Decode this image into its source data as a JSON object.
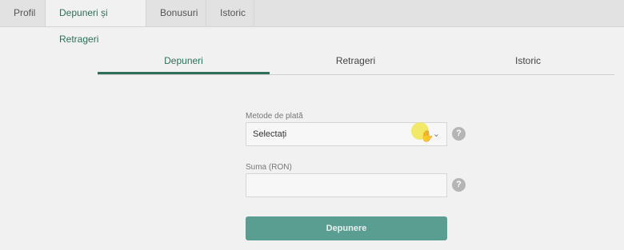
{
  "top_tabs": [
    {
      "label": "Profil"
    },
    {
      "label": "Depuneri și Retrageri"
    },
    {
      "label": "Bonusuri"
    },
    {
      "label": "Istoric"
    }
  ],
  "sub_tabs": [
    {
      "label": "Depuneri"
    },
    {
      "label": "Retrageri"
    },
    {
      "label": "Istoric"
    }
  ],
  "form": {
    "payment_method_label": "Metode de plată",
    "payment_method_value": "Selectați",
    "amount_label": "Suma (RON)",
    "amount_value": "",
    "help_glyph": "?",
    "submit_label": "Depunere"
  },
  "colors": {
    "accent": "#2f6f59",
    "button": "#5a9e92"
  },
  "icons": [
    "chevron-down-icon",
    "help-icon",
    "hand-cursor-icon"
  ]
}
